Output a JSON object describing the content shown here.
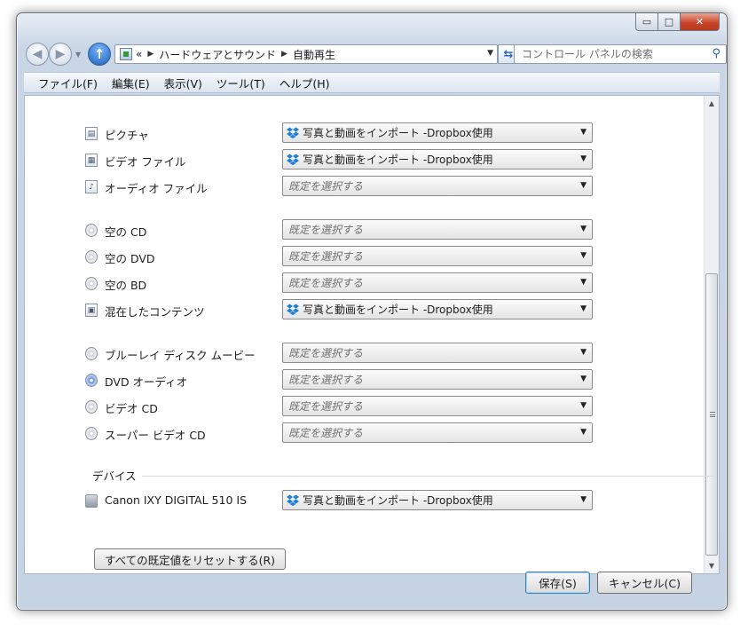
{
  "window": {
    "caption_buttons": {
      "minimize": "▭",
      "maximize": "□",
      "close": "✕"
    }
  },
  "nav": {
    "back_icon": "back-arrow-icon",
    "forward_icon": "forward-arrow-icon",
    "address": {
      "prefix": "«",
      "crumbs": [
        "ハードウェアとサウンド",
        "自動再生"
      ],
      "separator": "▶"
    },
    "search_placeholder": "コントロール パネルの検索"
  },
  "menu": [
    "ファイル(F)",
    "編集(E)",
    "表示(V)",
    "ツール(T)",
    "ヘルプ(H)"
  ],
  "rows": [
    {
      "label": "ピクチャ",
      "value": "写真と動画をインポート -Dropbox使用",
      "icon": "picture-icon"
    },
    {
      "label": "ビデオ ファイル",
      "value": "写真と動画をインポート -Dropbox使用",
      "icon": "video-file-icon"
    },
    {
      "label": "オーディオ ファイル",
      "value": "既定を選択する",
      "icon": "audio-file-icon"
    },
    {
      "label": "空の CD",
      "value": "既定を選択する",
      "icon": "cd-icon"
    },
    {
      "label": "空の DVD",
      "value": "既定を選択する",
      "icon": "dvd-icon"
    },
    {
      "label": "空の BD",
      "value": "既定を選択する",
      "icon": "bd-icon"
    },
    {
      "label": "混在したコンテンツ",
      "value": "写真と動画をインポート -Dropbox使用",
      "icon": "mixed-content-icon"
    },
    {
      "label": "ブルーレイ ディスク ムービー",
      "value": "既定を選択する",
      "icon": "bluray-movie-icon"
    },
    {
      "label": "DVD オーディオ",
      "value": "既定を選択する",
      "icon": "dvd-audio-icon"
    },
    {
      "label": "ビデオ CD",
      "value": "既定を選択する",
      "icon": "video-cd-icon"
    },
    {
      "label": "スーパー ビデオ CD",
      "value": "既定を選択する",
      "icon": "super-video-cd-icon"
    }
  ],
  "devices": {
    "heading": "デバイス",
    "items": [
      {
        "label": "Canon IXY DIGITAL 510 IS",
        "value": "写真と動画をインポート -Dropbox使用",
        "icon": "camera-icon"
      }
    ]
  },
  "reset_button": "すべての既定値をリセットする(R)",
  "buttons": {
    "save": "保存(S)",
    "cancel": "キャンセル(C)"
  },
  "colors": {
    "dropbox": "#1e7fd8",
    "accent": "#3c7fb1"
  }
}
